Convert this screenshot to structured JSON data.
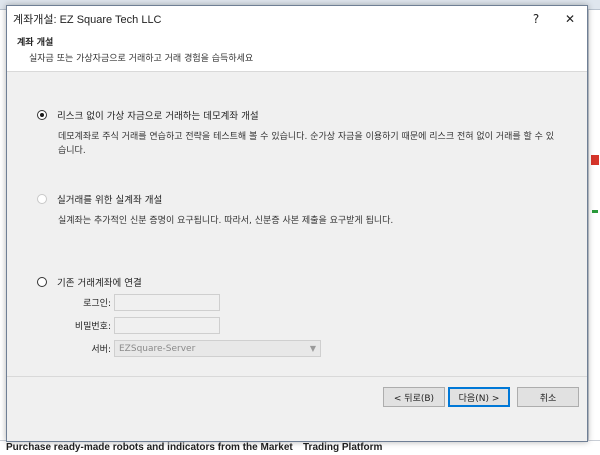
{
  "dialog": {
    "title": "계좌개설: EZ Square Tech LLC",
    "help_glyph": "?",
    "close_glyph": "✕"
  },
  "header": {
    "title": "계좌 개설",
    "subtitle": "실자금 또는 가상자금으로 거래하고 거래 경험을 습득하세요"
  },
  "options": {
    "demo": {
      "label": "리스크 없이 가상 자금으로 거래하는 데모계좌 개설",
      "desc": "데모계좌로 주식 거래를 연습하고 전략을 테스트해 볼 수 있습니다. 순가상 자금을 이용하기 때문에 리스크 전혀 없이 거래를 할 수 있습니다.",
      "selected": true
    },
    "real": {
      "label": "실거래를 위한 실계좌 개설",
      "desc": "실계좌는 추가적인 신분 증명이 요구됩니다. 따라서, 신분증 사본 제출을 요구받게 됩니다.",
      "selected": false
    },
    "existing": {
      "label": "기존 거래계좌에 연결",
      "selected": false
    }
  },
  "form": {
    "login_label": "로그인:",
    "login_value": "",
    "password_label": "비밀번호:",
    "password_value": "",
    "server_label": "서버:",
    "server_value": "EZSquare-Server"
  },
  "buttons": {
    "back": "< 뒤로(B)",
    "next": "다음(N) >",
    "cancel": "취소"
  },
  "background": {
    "bottom_text_left": "Purchase ready-made robots and indicators from the Market",
    "bottom_text_right": "Trading Platform"
  }
}
